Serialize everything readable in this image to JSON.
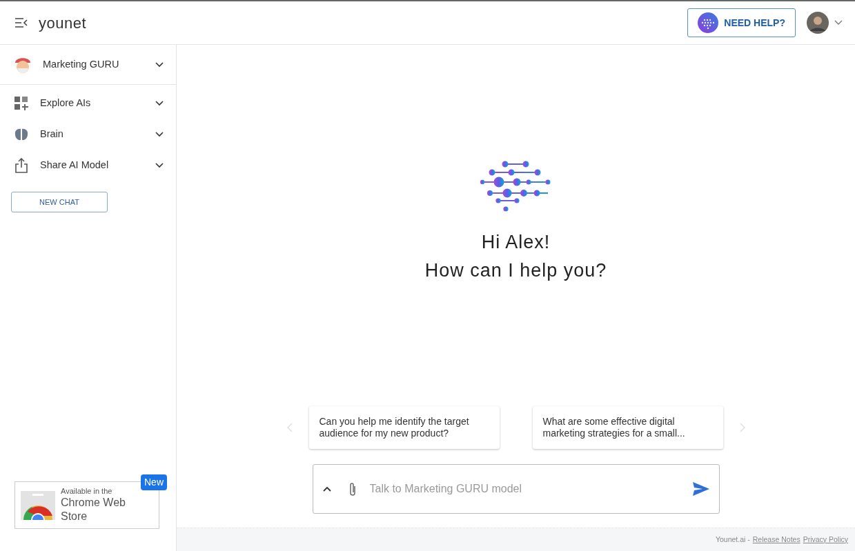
{
  "header": {
    "logo": "younet",
    "help_button": "NEED HELP?"
  },
  "sidebar": {
    "model": {
      "label": "Marketing GURU"
    },
    "items": [
      {
        "label": "Explore AIs",
        "kind": "grid"
      },
      {
        "label": "Brain",
        "kind": "brain"
      },
      {
        "label": "Share AI Model",
        "kind": "share"
      }
    ],
    "new_chat": "NEW CHAT",
    "store_badge": {
      "badge": "New",
      "line1": "Available in the",
      "line2": "Chrome Web Store"
    }
  },
  "greeting": {
    "line1": "Hi Alex!",
    "line2": "How can I help you?"
  },
  "suggestions": [
    "Can you help me identify the target audience for my new product?",
    "What are some effective digital marketing strategies for a small..."
  ],
  "composer": {
    "placeholder": "Talk to Marketing GURU model"
  },
  "footer": {
    "brand": "Younet.ai -",
    "links": [
      "Release Notes",
      "Privacy Policy"
    ]
  }
}
